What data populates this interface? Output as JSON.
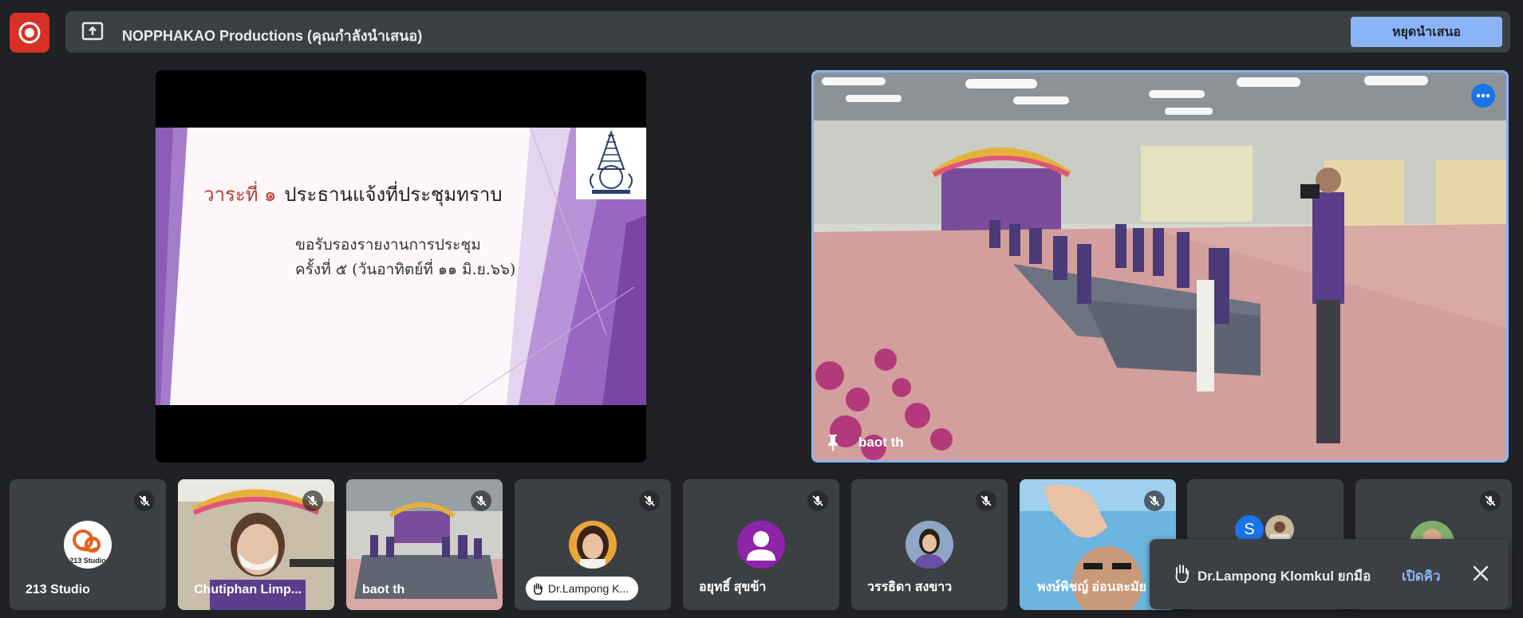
{
  "presenting": {
    "title": "NOPPHAKAO Productions (คุณกำลังนำเสนอ)",
    "stop_label": "หยุดนำเสนอ"
  },
  "slide": {
    "agenda": "วาระที่ ๑",
    "topic": "ประธานแจ้งที่ประชุมทราบ",
    "line1": "ขอรับรองรายงานการประชุม",
    "line2": "ครั้งที่ ๕ (วันอาทิตย์ที่ ๑๑ มิ.ย.๖๖)"
  },
  "pinned": {
    "name": "baot th"
  },
  "participants": [
    {
      "name": "213 Studio",
      "avatar_text": "213 Studio"
    },
    {
      "name": "Chutiphan Limp..."
    },
    {
      "name": "baot th"
    },
    {
      "name": "Dr.Lampong K..."
    },
    {
      "name": "อยุทธิ์ สุขข้า"
    },
    {
      "name": "วรรธิดา สงขาว"
    },
    {
      "name": "พงษ์พิชญ์ อ่อนละมัย"
    },
    {
      "name": "",
      "avatar_letter": "S"
    },
    {
      "name": ""
    }
  ],
  "toast": {
    "message": "Dr.Lampong Klomkul ยกมือ",
    "action": "เปิดคิว"
  },
  "colors": {
    "background": "#202124",
    "surface": "#3c4043",
    "accent": "#8ab4f8",
    "record": "#d93025",
    "slide_purple": "#8e5cb8"
  }
}
